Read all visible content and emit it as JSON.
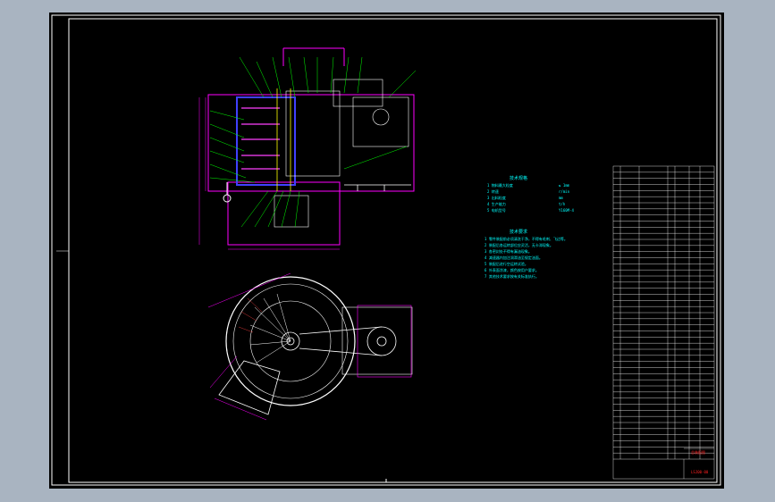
{
  "drawing": {
    "title_block": {
      "drawing_title": "总装配图",
      "drawing_number": "LSJ00-00"
    },
    "spec_heading": "技术规格",
    "specs": [
      {
        "label": "1 物料最大粒度",
        "value": "≤ 1mm"
      },
      {
        "label": "2 转速",
        "value": "r/min"
      },
      {
        "label": "3 出料粒度",
        "value": "mm"
      },
      {
        "label": "4 生产能力",
        "value": "t/h"
      },
      {
        "label": "5 电机型号",
        "value": "Y160M-4"
      }
    ],
    "notes_heading": "技术要求",
    "notes": [
      "1 零件装配前必须清洗干净，不得有毛刺、飞边等。",
      "2 装配后各运转部位应灵活，无卡滞现象。",
      "3 各密封处不得有漏油现象。",
      "4 减速器内加注润滑油至规定油面。",
      "5 装配后进行空运转试验。",
      "6 外表面涂漆，颜色按用户要求。",
      "7 其他技术要求按有关标准执行。"
    ],
    "bom_rows": 48
  },
  "colors": {
    "background": "#000000",
    "frame": "#ffffff",
    "outline": "#ff00ff",
    "geometry": "#ffffff",
    "leader": "#00ff00",
    "notes": "#00ffff",
    "title": "#ff2020"
  }
}
